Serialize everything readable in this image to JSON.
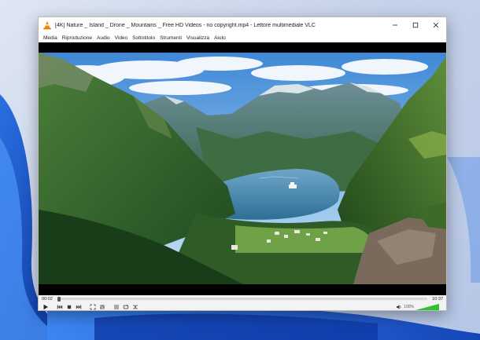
{
  "window": {
    "title": "[4K] Nature _ Island _ Drone _ Mountains _ Free HD Videos - no copyright.mp4 - Lettore multimediale VLC"
  },
  "menu": {
    "items": [
      "Media",
      "Riproduzione",
      "Audio",
      "Video",
      "Sottotitolo",
      "Strumenti",
      "Visualizza",
      "Aiuto"
    ]
  },
  "playback": {
    "elapsed": "00:02",
    "total": "10:37",
    "progress": 0.005
  },
  "volume": {
    "label": "100%",
    "level": 1.0,
    "accent_color": "#2fc22f"
  },
  "icons": {
    "app": "vlc-cone-icon",
    "minimize": "minimize-icon",
    "maximize": "maximize-icon",
    "close": "close-icon",
    "play": "play-icon",
    "previous": "previous-icon",
    "stop": "stop-icon",
    "next": "next-icon",
    "fullscreen": "fullscreen-icon",
    "extended_settings": "equalizer-icon",
    "playlist": "playlist-icon",
    "loop": "loop-icon",
    "shuffle": "shuffle-icon",
    "speaker": "speaker-icon"
  }
}
